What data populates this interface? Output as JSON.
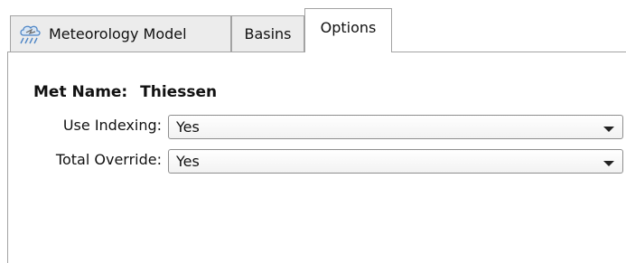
{
  "tabs": [
    {
      "label": "Meteorology Model",
      "icon": "rain-cloud-icon"
    },
    {
      "label": "Basins"
    },
    {
      "label": "Options",
      "active": true
    }
  ],
  "met_name": {
    "label": "Met Name:",
    "value": "Thiessen"
  },
  "fields": {
    "use_indexing": {
      "label": "Use Indexing:",
      "value": "Yes"
    },
    "total_override": {
      "label": "Total Override:",
      "value": "Yes"
    }
  },
  "colors": {
    "tab_inactive": "#ececec",
    "border": "#a3a3a3",
    "icon_blue": "#4f86c6"
  }
}
